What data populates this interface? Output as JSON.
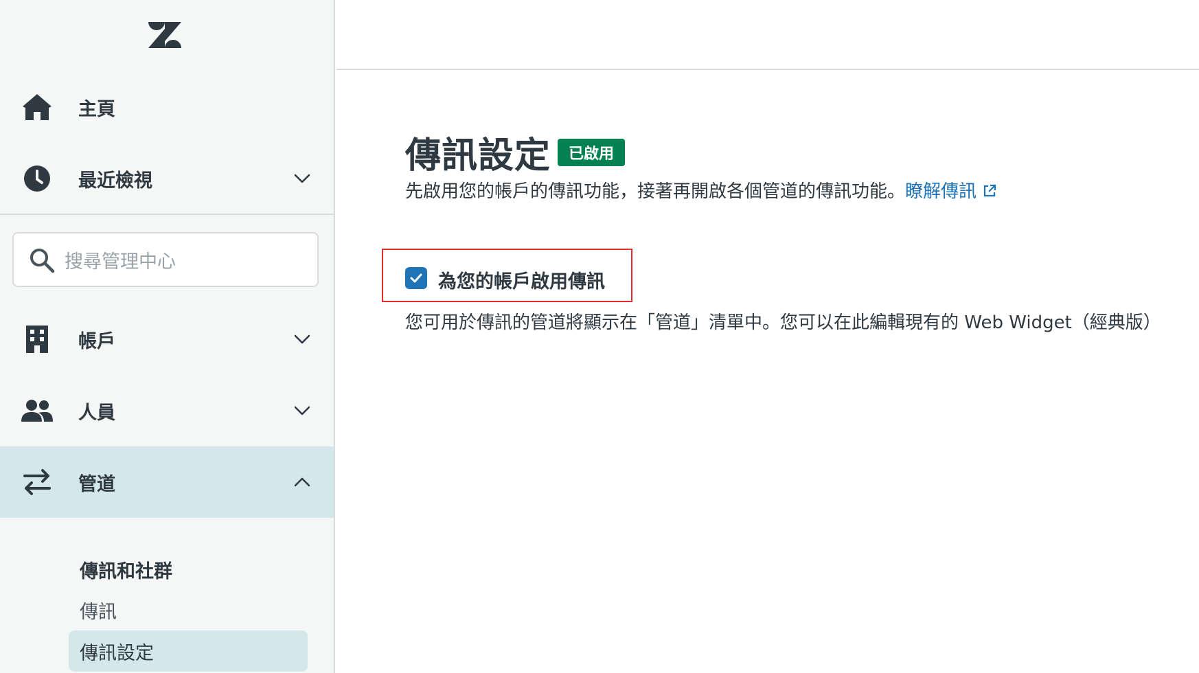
{
  "sidebar": {
    "logo": "zendesk-logo",
    "items": [
      {
        "label": "主頁",
        "icon": "home-icon"
      },
      {
        "label": "最近檢視",
        "icon": "clock-icon"
      },
      {
        "label": "帳戶",
        "icon": "building-icon"
      },
      {
        "label": "人員",
        "icon": "people-icon"
      },
      {
        "label": "管道",
        "icon": "channels-arrows-icon"
      }
    ],
    "search": {
      "placeholder": "搜尋管理中心"
    },
    "subnav": {
      "heading": "傳訊和社群",
      "links": [
        "傳訊",
        "傳訊設定"
      ]
    }
  },
  "main": {
    "title": "傳訊設定",
    "badge": "已啟用",
    "description": "先啟用您的帳戶的傳訊功能，接著再開啟各個管道的傳訊功能。",
    "learn_link": "瞭解傳訊",
    "checkbox": {
      "label": "為您的帳戶啟用傳訊",
      "checked": true
    },
    "hint": "您可用於傳訊的管道將顯示在「管道」清單中。您可以在此編輯現有的 Web Widget（經典版）"
  },
  "colors": {
    "badge_green": "#038153",
    "link_blue": "#1f73b7",
    "active_bg": "#d4e7e9",
    "highlight_red": "#e22b2b"
  }
}
